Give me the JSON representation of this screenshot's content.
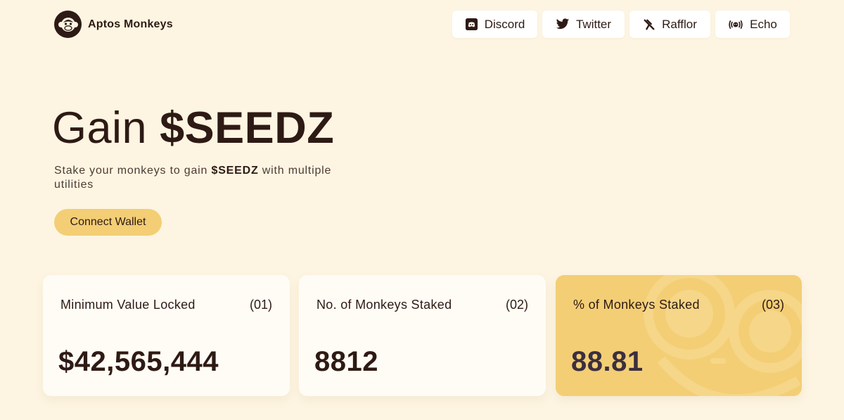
{
  "header": {
    "brand_name": "Aptos Monkeys",
    "logo_icon": "monkey-logo-icon",
    "nav": [
      {
        "label": "Discord",
        "icon": "discord-icon"
      },
      {
        "label": "Twitter",
        "icon": "twitter-icon"
      },
      {
        "label": "Rafflor",
        "icon": "rafflor-icon"
      },
      {
        "label": "Echo",
        "icon": "echo-icon"
      }
    ]
  },
  "hero": {
    "title_prefix": "Gain",
    "title_token": "$SEEDZ",
    "subtitle_before": "Stake your monkeys to gain",
    "subtitle_token": "$SEEDZ",
    "subtitle_after": "with multiple utilities",
    "connect_label": "Connect Wallet"
  },
  "stats": [
    {
      "label": "Minimum Value Locked",
      "index": "(01)",
      "value": "$42,565,444"
    },
    {
      "label": "No. of Monkeys Staked",
      "index": "(02)",
      "value": "8812"
    },
    {
      "label": "% of Monkeys Staked",
      "index": "(03)",
      "value": "88.81"
    }
  ],
  "colors": {
    "background": "#fdf5e2",
    "accent": "#f3ce75",
    "text": "#2e1a14",
    "card": "#fffcf6"
  }
}
